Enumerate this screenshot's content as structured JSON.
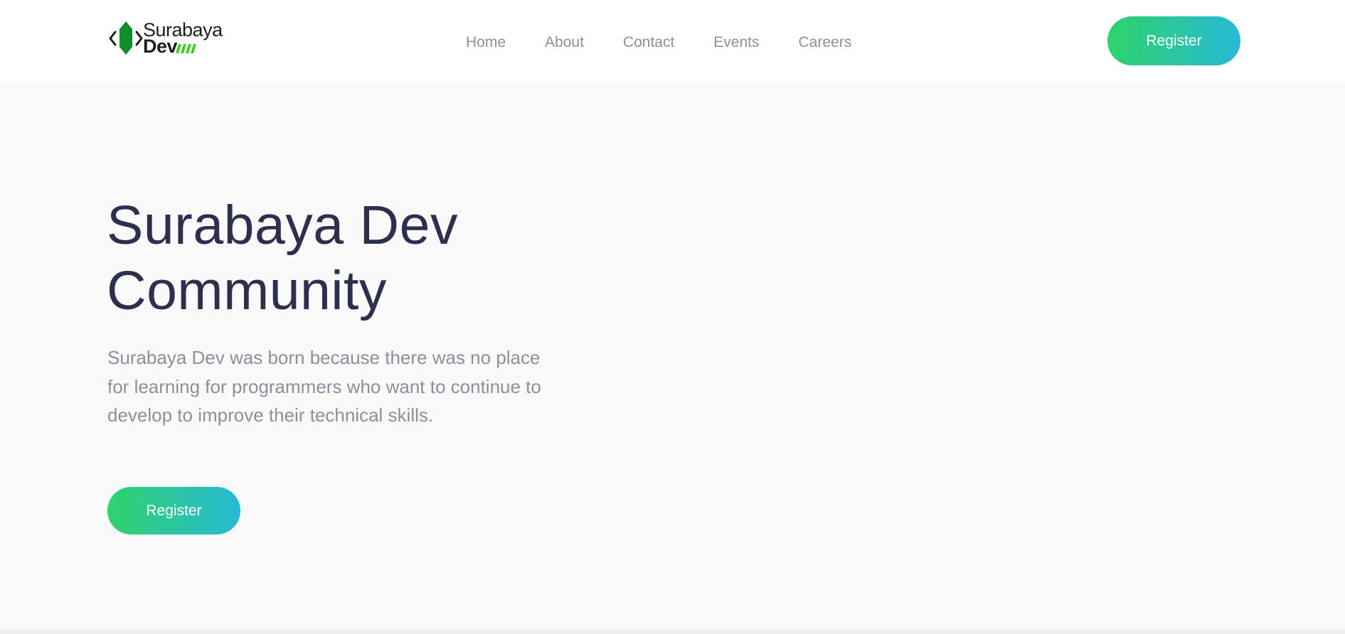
{
  "brand": {
    "name_top": "Surabaya",
    "name_bottom": "Dev",
    "colors": {
      "logo_green": "#0f8f2a",
      "stripe_green": "#38d11b"
    },
    "logo_icon": "code-brackets-leaf-icon"
  },
  "nav": {
    "links": [
      "Home",
      "About",
      "Contact",
      "Events",
      "Careers"
    ],
    "register_label": "Register"
  },
  "hero": {
    "title_line1": "Surabaya Dev",
    "title_line2": "Community",
    "description": "Surabaya Dev was born because there was no place for learning for programmers who want to continue to develop to improve their technical skills.",
    "register_label": "Register"
  },
  "theme": {
    "gradient_start": "#2fd36a",
    "gradient_end": "#27b9d6",
    "title_color": "#2c2f4d",
    "muted_text": "#8c8f9c",
    "hero_bg": "#f9f9fa"
  }
}
